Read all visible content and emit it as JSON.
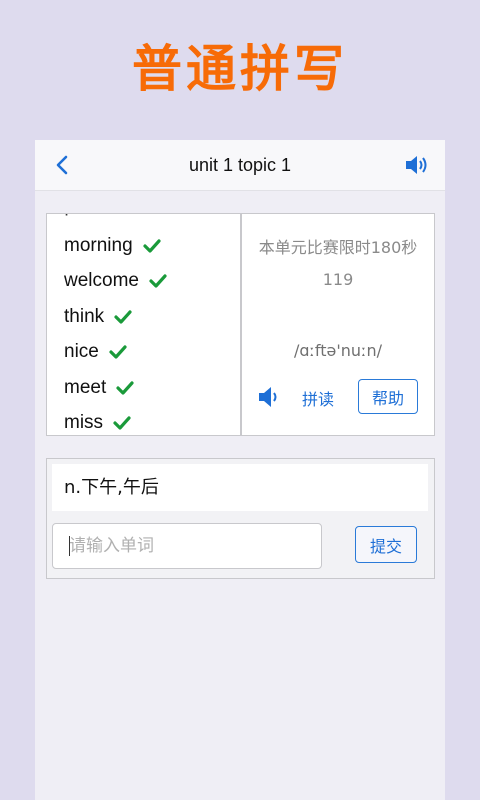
{
  "banner": {
    "title": "普通拼写"
  },
  "header": {
    "title": "unit 1 topic 1",
    "back_icon": "chevron-left-icon",
    "sound_icon": "speaker-icon",
    "accent": "#1e6fd6"
  },
  "words": {
    "items": [
      {
        "word": "morning",
        "status": "correct"
      },
      {
        "word": "welcome",
        "status": "correct"
      },
      {
        "word": "think",
        "status": "correct"
      },
      {
        "word": "nice",
        "status": "correct"
      },
      {
        "word": "meet",
        "status": "correct"
      },
      {
        "word": "miss",
        "status": "correct"
      }
    ],
    "check_color": "#1a9a3a"
  },
  "info": {
    "time_limit": "本单元比赛限时180秒",
    "countdown": "119",
    "phonetic": "/ɑːftə'nuːn/",
    "spell_label": "拼读",
    "help_label": "帮助"
  },
  "answer": {
    "meaning": "n.下午,午后",
    "input_value": "",
    "input_placeholder": "请输入单词",
    "submit_label": "提交"
  },
  "colors": {
    "banner": "#f76b07",
    "background": "#dedbee"
  }
}
